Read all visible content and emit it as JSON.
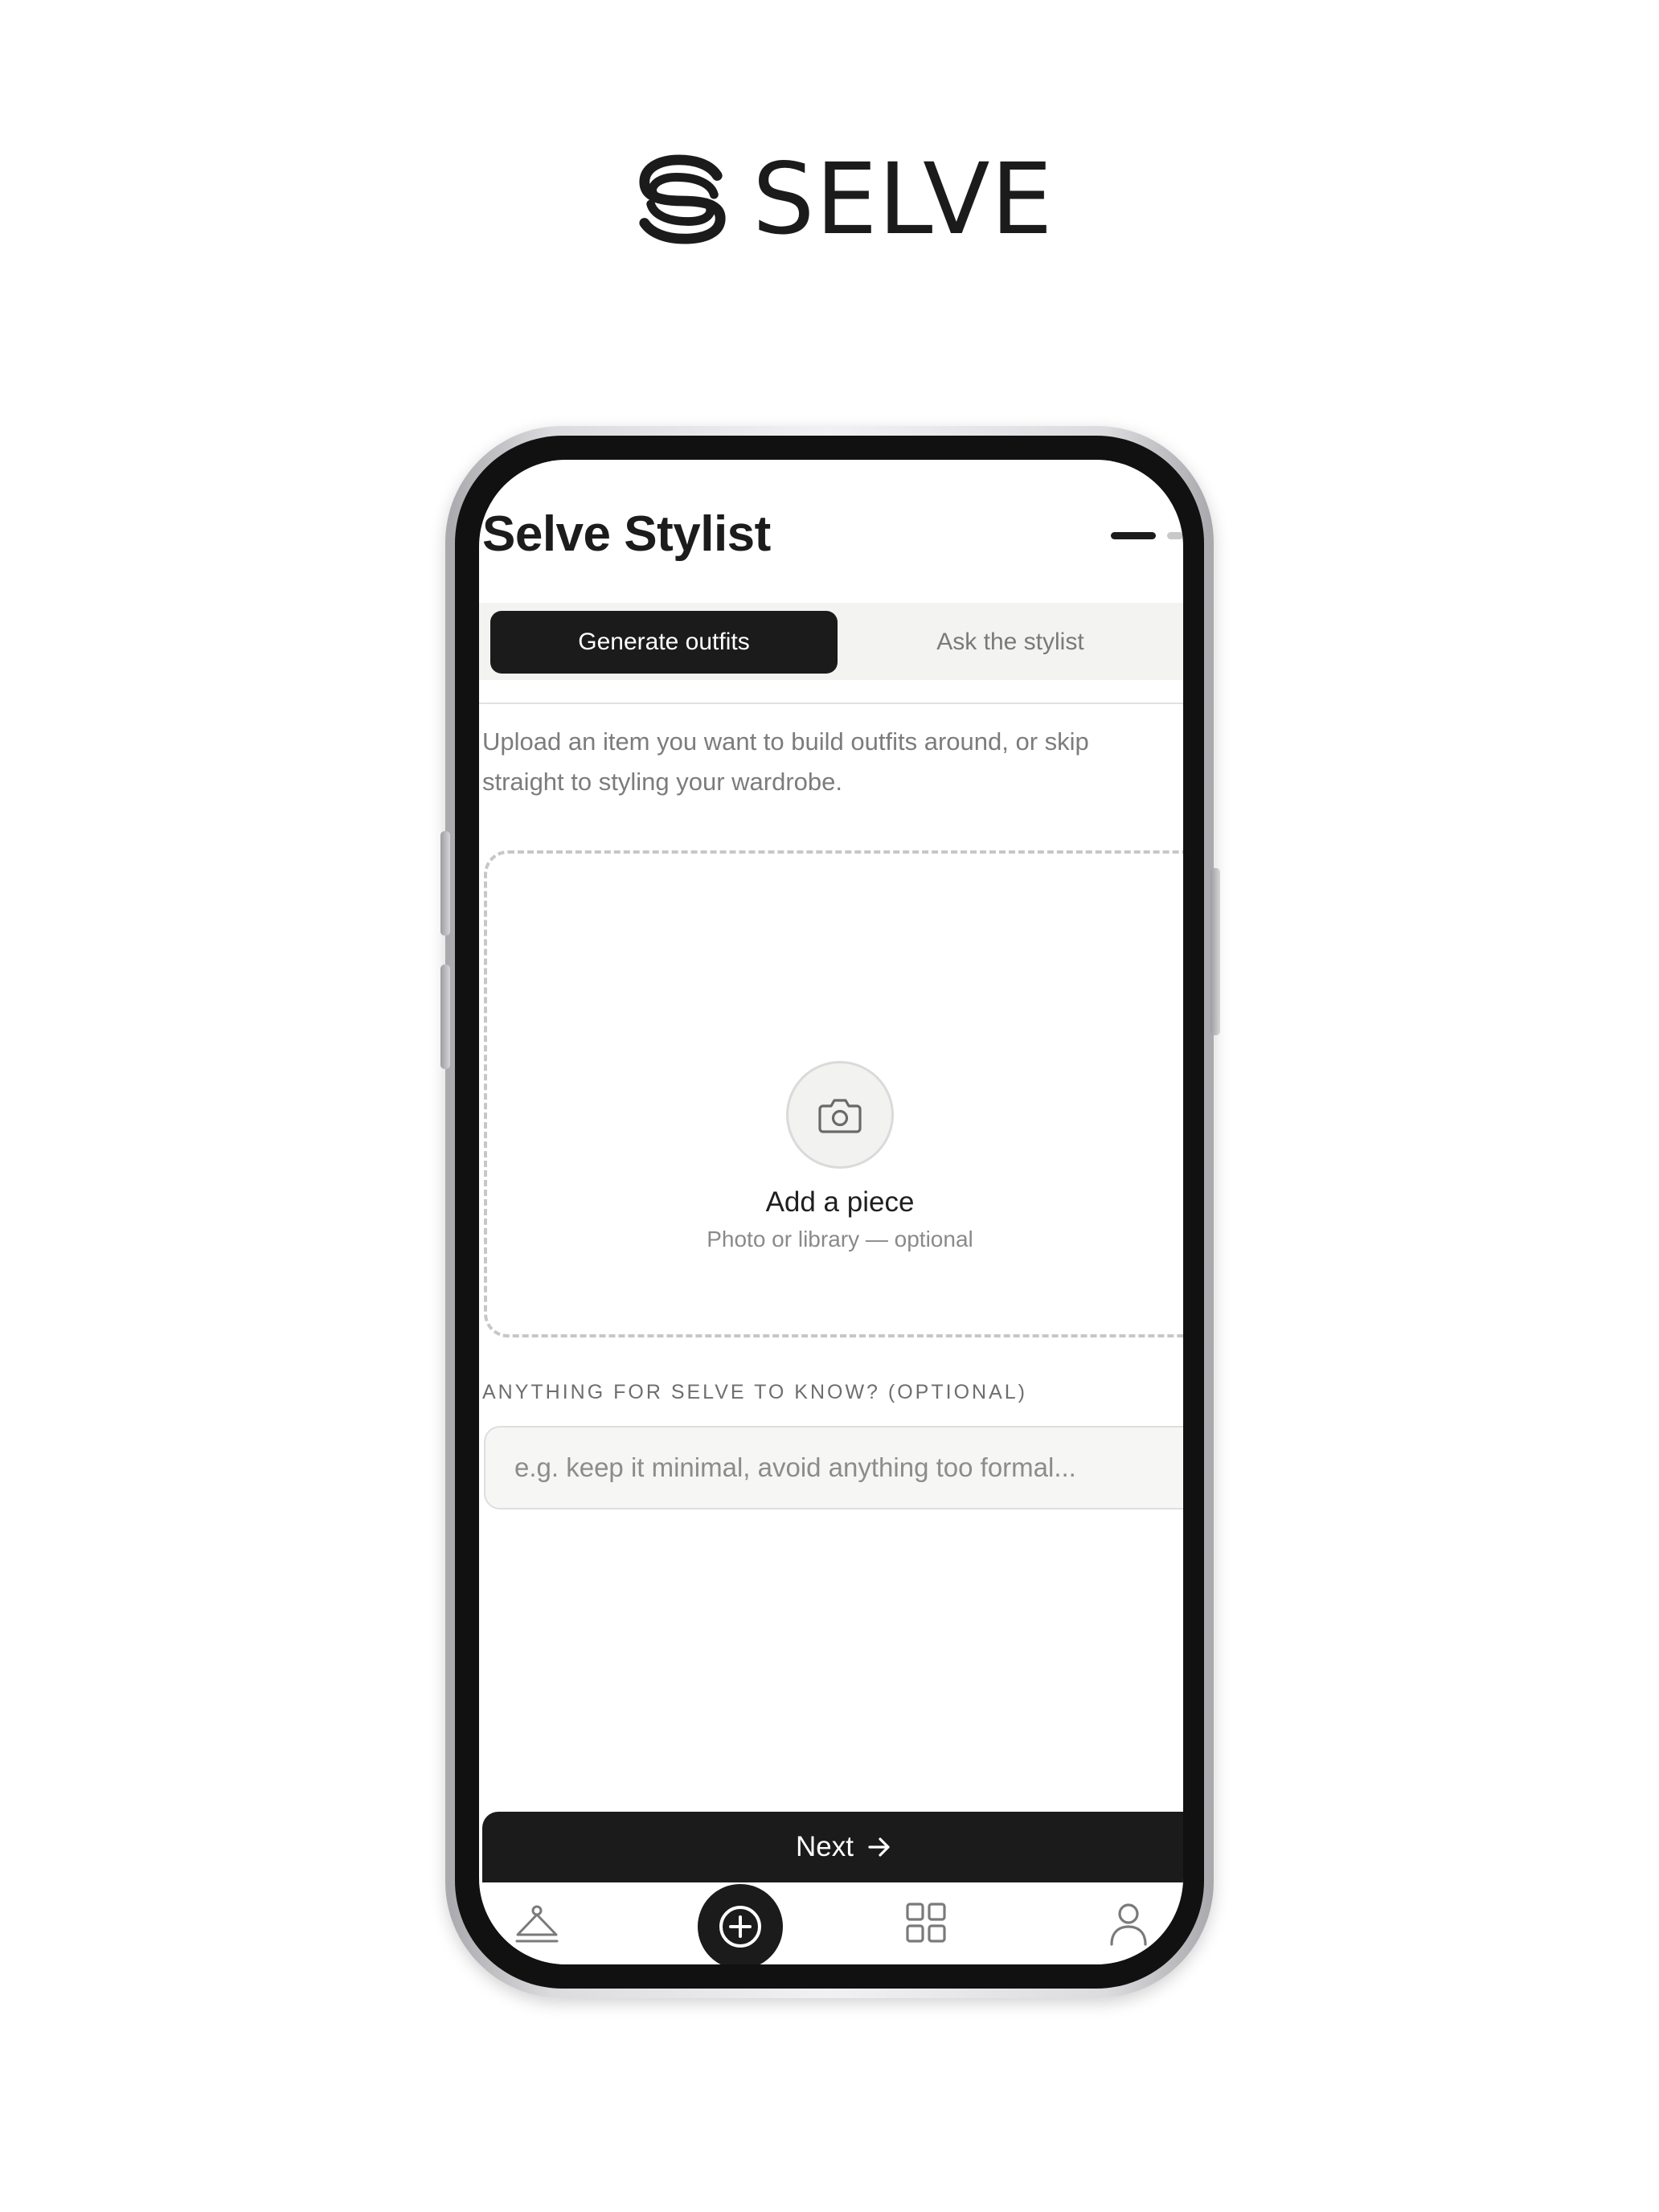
{
  "brand": {
    "name": "SELVE",
    "logo_icon": "selve-s-logo-icon",
    "color": "#1b1b1b"
  },
  "header": {
    "title": "Selve Stylist",
    "menu_icon": "menu-dash-icon"
  },
  "tabs": [
    {
      "label": "Generate outfits",
      "active": true
    },
    {
      "label": "Ask the stylist",
      "active": false
    }
  ],
  "intro": {
    "text": "Upload an item you want to build outfits around, or skip straight to styling your wardrobe."
  },
  "upload": {
    "icon": "camera-icon",
    "title": "Add a piece",
    "subtitle": "Photo or library — optional"
  },
  "notes": {
    "label": "ANYTHING FOR SELVE TO KNOW? (OPTIONAL)",
    "value": "",
    "placeholder": "e.g. keep it minimal, avoid anything too formal..."
  },
  "next_button": {
    "label": "Next",
    "icon": "arrow-right-icon"
  },
  "bottom_nav": {
    "items": [
      {
        "icon": "hanger-icon",
        "active": false
      },
      {
        "icon": "plus-circle-icon",
        "active": true
      },
      {
        "icon": "grid-icon",
        "active": false
      },
      {
        "icon": "person-icon",
        "active": false
      }
    ]
  },
  "colors": {
    "primary": "#1b1b1b",
    "muted_text": "#7c7c7c",
    "surface": "#f3f3f2",
    "border": "#c7c7c7"
  }
}
